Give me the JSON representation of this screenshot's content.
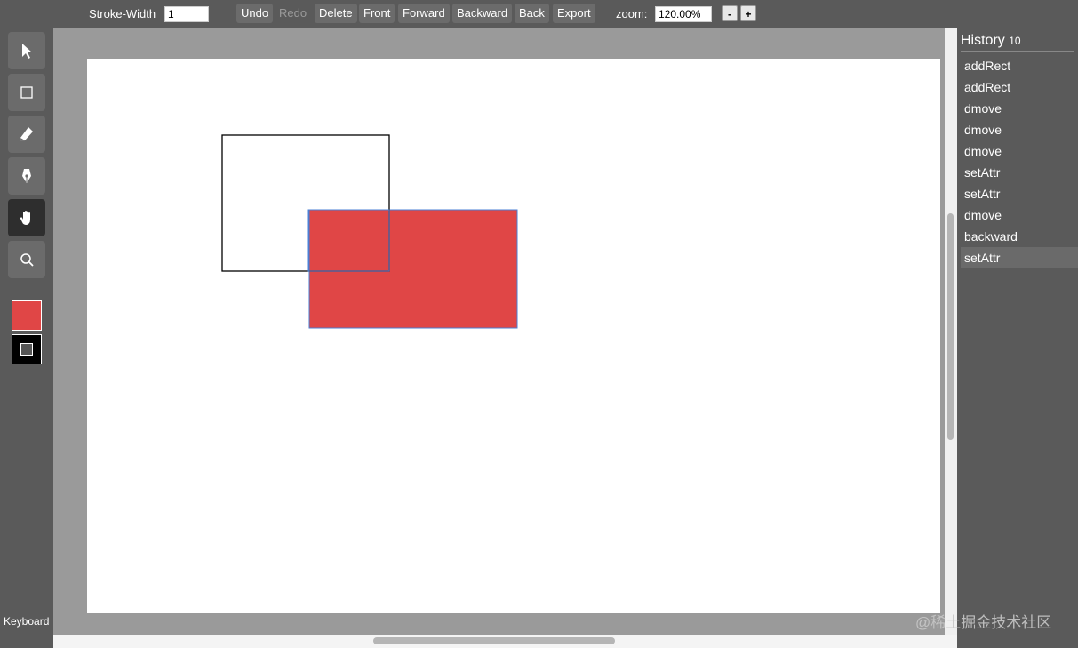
{
  "toolbar": {
    "stroke_width_label": "Stroke-Width",
    "stroke_width_value": "1",
    "buttons": {
      "undo": "Undo",
      "redo": "Redo",
      "delete": "Delete",
      "front": "Front",
      "forward": "Forward",
      "backward": "Backward",
      "back": "Back",
      "export": "Export"
    },
    "zoom_label": "zoom:",
    "zoom_value": "120.00%",
    "zoom_out": "-",
    "zoom_in": "+"
  },
  "tools": [
    {
      "name": "select",
      "icon": "cursor-arrow-icon"
    },
    {
      "name": "rectangle",
      "icon": "rectangle-icon"
    },
    {
      "name": "pencil",
      "icon": "pencil-icon"
    },
    {
      "name": "pen",
      "icon": "pen-nib-icon"
    },
    {
      "name": "pan",
      "icon": "hand-icon",
      "active": true
    },
    {
      "name": "zoom",
      "icon": "magnifier-icon"
    }
  ],
  "colors": {
    "fill": "#e04646",
    "stroke": "#000000",
    "selection": "#4a7fd4"
  },
  "keyboard_label": "Keyboard",
  "history": {
    "title": "History",
    "count": "10",
    "items": [
      "addRect",
      "addRect",
      "dmove",
      "dmove",
      "dmove",
      "setAttr",
      "setAttr",
      "dmove",
      "backward",
      "setAttr"
    ],
    "current_index": 9
  },
  "watermark": "@稀土掘金技术社区"
}
